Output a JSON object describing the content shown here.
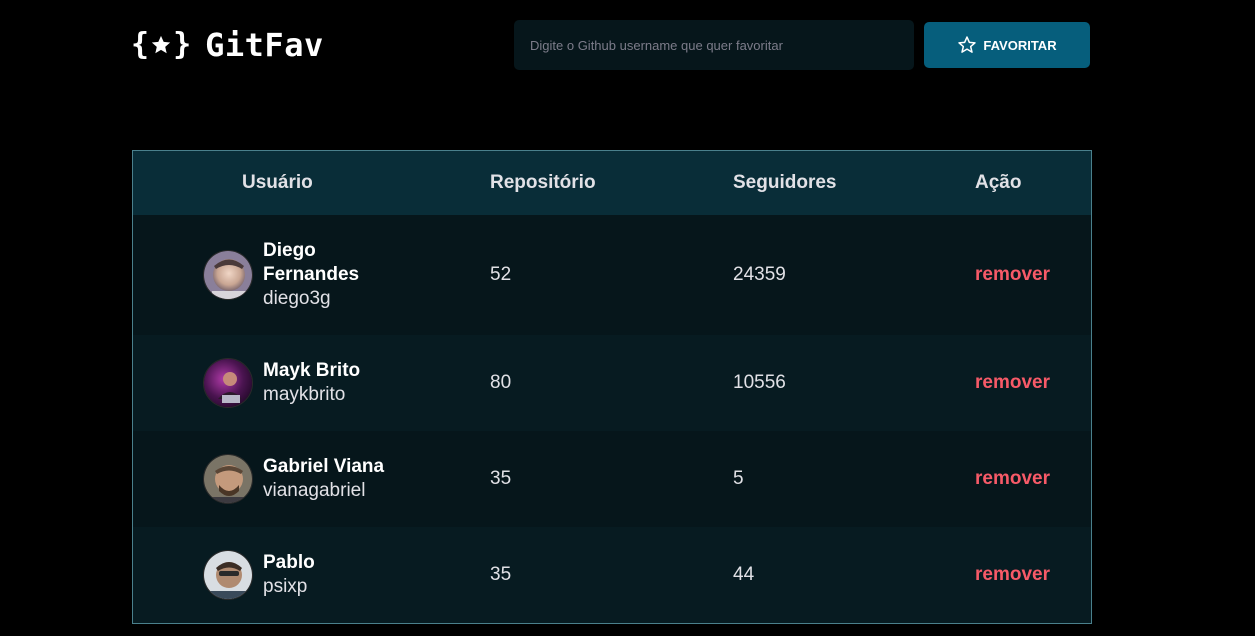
{
  "app": {
    "logo_text": "GitFav"
  },
  "search": {
    "placeholder": "Digite o Github username que quer favoritar",
    "value": ""
  },
  "favorite_button": {
    "label": "FAVORITAR"
  },
  "table": {
    "headers": {
      "user": "Usuário",
      "repos": "Repositório",
      "followers": "Seguidores",
      "action": "Ação"
    },
    "rows": [
      {
        "name": "Diego Fernandes",
        "login": "diego3g",
        "repos": "52",
        "followers": "24359",
        "action": "remover"
      },
      {
        "name": "Mayk Brito",
        "login": "maykbrito",
        "repos": "80",
        "followers": "10556",
        "action": "remover"
      },
      {
        "name": "Gabriel Viana",
        "login": "vianagabriel",
        "repos": "35",
        "followers": "5",
        "action": "remover"
      },
      {
        "name": "Pablo",
        "login": "psixp",
        "repos": "35",
        "followers": "44",
        "action": "remover"
      }
    ]
  },
  "colors": {
    "background": "#000000",
    "input_bg": "#06161b",
    "button_bg": "#065e7c",
    "table_header_bg": "#092d38",
    "table_border": "#4a808c",
    "remove_text": "#f75a68"
  },
  "icons": {
    "logo": "star-braces-icon",
    "button": "star-outline-icon",
    "avatars": "user-avatar-photo"
  }
}
